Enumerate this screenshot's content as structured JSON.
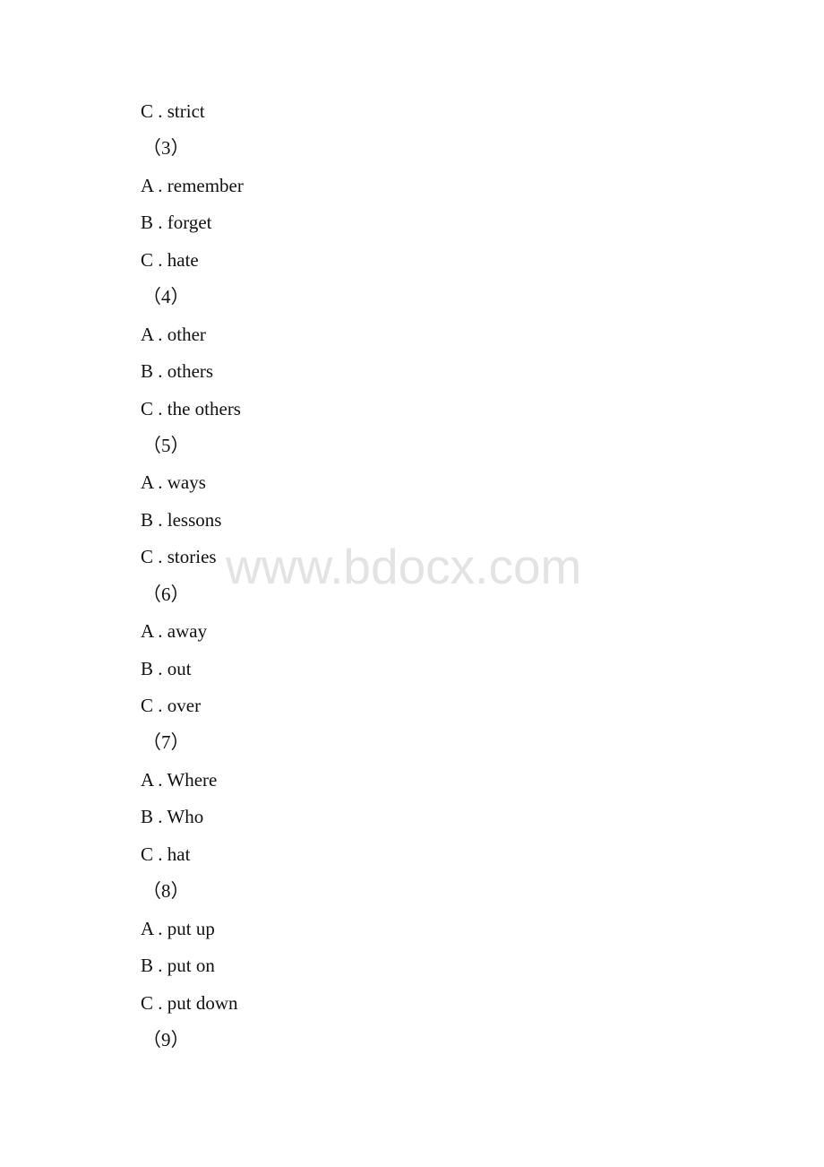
{
  "watermark": "www.bdocx.com",
  "lines": [
    {
      "type": "option",
      "text": "C . strict"
    },
    {
      "type": "number",
      "text": "（3）"
    },
    {
      "type": "option",
      "text": "A . remember"
    },
    {
      "type": "option",
      "text": "B . forget"
    },
    {
      "type": "option",
      "text": "C . hate"
    },
    {
      "type": "number",
      "text": "（4）"
    },
    {
      "type": "option",
      "text": "A . other"
    },
    {
      "type": "option",
      "text": "B . others"
    },
    {
      "type": "option",
      "text": "C . the others"
    },
    {
      "type": "number",
      "text": "（5）"
    },
    {
      "type": "option",
      "text": "A . ways"
    },
    {
      "type": "option",
      "text": "B . lessons"
    },
    {
      "type": "option",
      "text": "C . stories"
    },
    {
      "type": "number",
      "text": "（6）"
    },
    {
      "type": "option",
      "text": "A . away"
    },
    {
      "type": "option",
      "text": "B . out"
    },
    {
      "type": "option",
      "text": "C . over"
    },
    {
      "type": "number",
      "text": "（7）"
    },
    {
      "type": "option",
      "text": "A . Where"
    },
    {
      "type": "option",
      "text": "B . Who"
    },
    {
      "type": "option",
      "text": "C . hat"
    },
    {
      "type": "number",
      "text": "（8）"
    },
    {
      "type": "option",
      "text": "A . put up"
    },
    {
      "type": "option",
      "text": "B . put on"
    },
    {
      "type": "option",
      "text": "C . put down"
    },
    {
      "type": "number",
      "text": "（9）"
    }
  ]
}
